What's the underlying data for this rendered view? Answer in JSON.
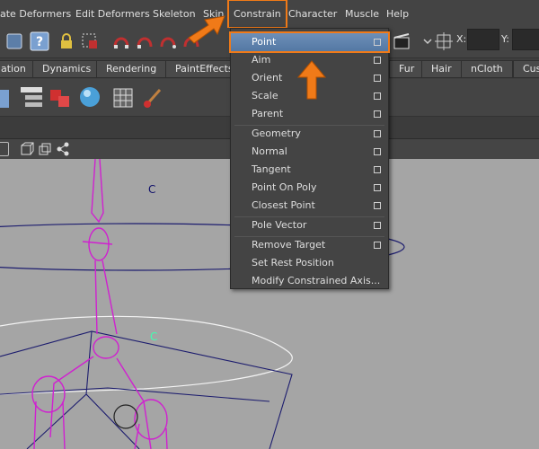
{
  "menubar": {
    "items": [
      "ate Deformers",
      "Edit Deformers",
      "Skeleton",
      "Skin",
      "Constrain",
      "Character",
      "Muscle",
      "Help"
    ]
  },
  "toolbar": {
    "x_label": "X:",
    "y_label": "Y:"
  },
  "shelf_tabs": [
    "ation",
    "Dynamics",
    "Rendering",
    "PaintEffects",
    "Fur",
    "Hair",
    "nCloth",
    "Cus"
  ],
  "viewport": {
    "locator_labels": [
      "C",
      "C"
    ]
  },
  "dropdown": {
    "items": [
      {
        "label": "Point",
        "has_option_box": true
      },
      {
        "label": "Aim",
        "has_option_box": true
      },
      {
        "label": "Orient",
        "has_option_box": true
      },
      {
        "label": "Scale",
        "has_option_box": true
      },
      {
        "label": "Parent",
        "has_option_box": true
      },
      {
        "label": "Geometry",
        "has_option_box": true
      },
      {
        "label": "Normal",
        "has_option_box": true
      },
      {
        "label": "Tangent",
        "has_option_box": true
      },
      {
        "label": "Point On Poly",
        "has_option_box": true
      },
      {
        "label": "Closest Point",
        "has_option_box": true
      },
      {
        "label": "Pole Vector",
        "has_option_box": true
      },
      {
        "label": "Remove Target",
        "has_option_box": true
      },
      {
        "label": "Set Rest Position",
        "has_option_box": false
      },
      {
        "label": "Modify Constrained Axis...",
        "has_option_box": false
      }
    ]
  },
  "colors": {
    "highlight": "#f07a18",
    "selection": "#5a7ead",
    "skeleton": "#d020d0",
    "grid_lines": "#1c1c6e"
  }
}
